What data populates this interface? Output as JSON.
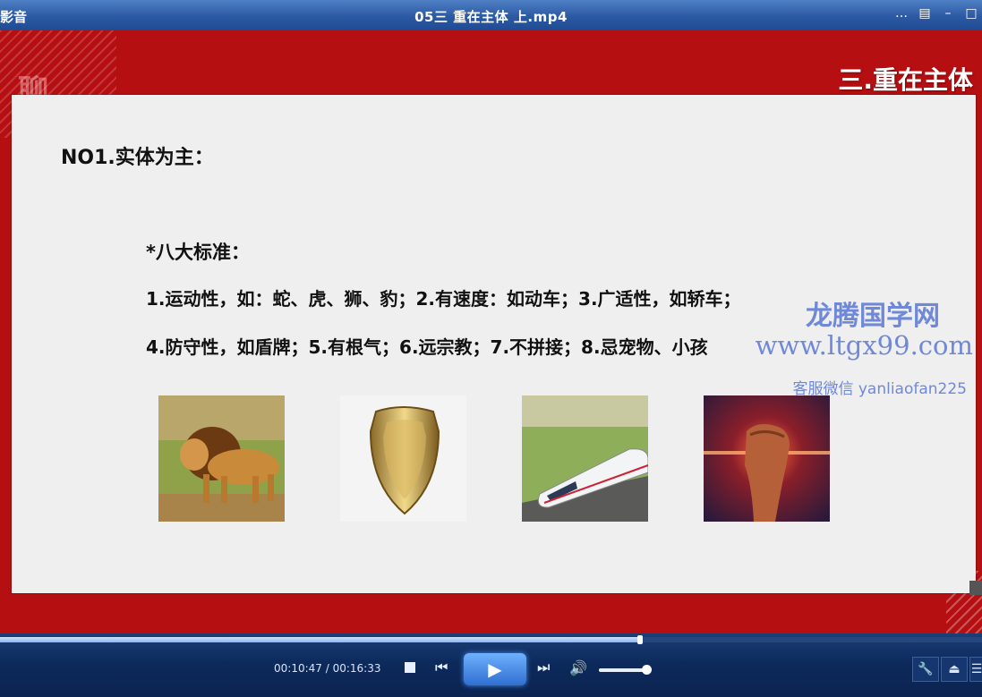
{
  "titlebar": {
    "app_name": "影音",
    "file_title": "05三 重在主体 上.mp4",
    "icons": [
      "chat-icon",
      "skin-icon",
      "minimize-icon",
      "maximize-icon"
    ]
  },
  "slide": {
    "section_title": "三.重在主体",
    "logo_text": "聊",
    "heading": "NO1.实体为主：",
    "subheading": "*八大标准：",
    "line1": "1.运动性，如：蛇、虎、狮、豹；2.有速度：如动车；3.广适性，如轿车；",
    "line2": "4.防守性，如盾牌；5.有根气；6.远宗教；7.不拼接；8.忌宠物、小孩",
    "pictures": [
      "lion",
      "shield",
      "train",
      "fist"
    ]
  },
  "watermark": {
    "name": "龙腾国学网",
    "url": "www.ltgx99.com",
    "contact": "客服微信 yanliaofan225"
  },
  "player": {
    "current_time": "00:10:47",
    "total_time": "00:16:33",
    "time_display": "00:10:47 / 00:16:33",
    "progress_fraction": 0.652,
    "volume_fraction": 0.95
  }
}
